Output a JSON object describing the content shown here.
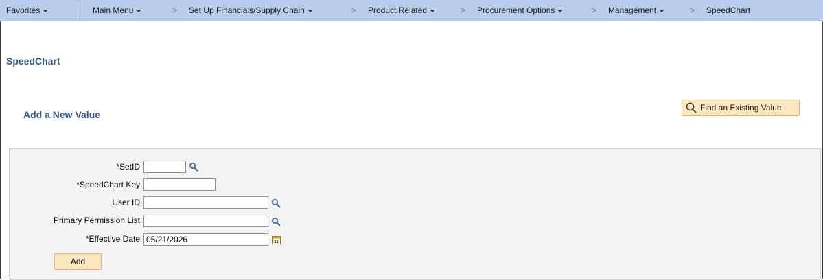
{
  "nav": {
    "favorites": "Favorites",
    "main_menu": "Main Menu",
    "breadcrumbs": [
      "Set Up Financials/Supply Chain",
      "Product Related",
      "Procurement Options",
      "Management",
      "SpeedChart"
    ],
    "separator": ">"
  },
  "page_title": "SpeedChart",
  "subtitle": "Add a New Value",
  "find_existing_label": "Find an Existing Value",
  "form": {
    "setid_label": "*SetID",
    "setid_value": "",
    "speedchart_key_label": "*SpeedChart Key",
    "speedchart_key_value": "",
    "user_id_label": "User ID",
    "user_id_value": "",
    "primary_permission_label": "Primary Permission List",
    "primary_permission_value": "",
    "effective_date_label": "*Effective Date",
    "effective_date_value": "05/21/2026",
    "add_label": "Add"
  },
  "colors": {
    "navbar": "#b7cdea",
    "title": "#365a84",
    "button_bg": "#fde6bd",
    "button_border": "#e4b66a"
  },
  "icons": [
    "chevron-down-icon",
    "search-icon",
    "lookup-icon",
    "calendar-icon"
  ]
}
